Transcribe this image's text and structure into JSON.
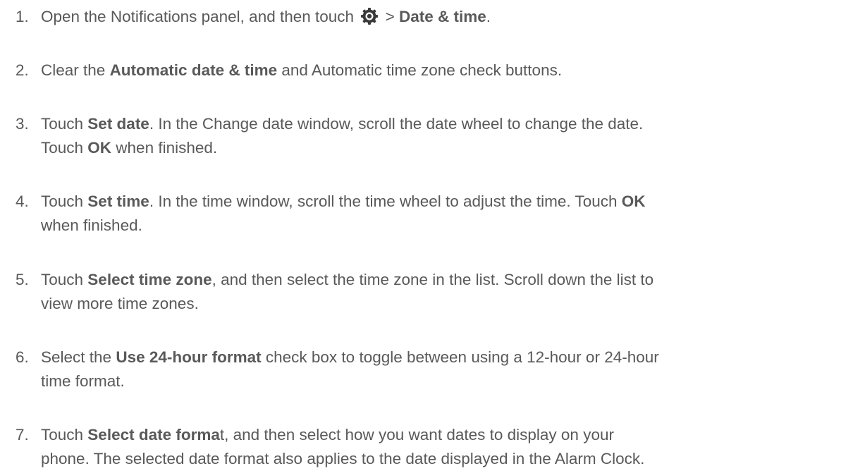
{
  "steps": [
    {
      "num": "1.",
      "line1": {
        "t1": "Open the Notifications panel, and then touch ",
        "sep": " > ",
        "b1": "Date & time",
        "t2": "."
      },
      "icon": "settings-gear-icon"
    },
    {
      "num": "2.",
      "line1": {
        "t1": "Clear the ",
        "b1": "Automatic date & time",
        "t2": " and Automatic time zone check buttons."
      }
    },
    {
      "num": "3.",
      "line1": {
        "t1": "Touch ",
        "b1": "Set date",
        "t2": ". In the Change date window, scroll the date wheel to change the date."
      },
      "line2": {
        "t1": "Touch ",
        "b1": "OK",
        "t2": " when finished."
      }
    },
    {
      "num": "4.",
      "line1": {
        "t1": "Touch ",
        "b1": "Set time",
        "t2": ". In the time window, scroll the time wheel to adjust the time. Touch ",
        "b2": "OK"
      },
      "line2": {
        "t1": "when finished."
      }
    },
    {
      "num": "5.",
      "line1": {
        "t1": "Touch ",
        "b1": "Select time zone",
        "t2": ", and then select the time zone in the list. Scroll down the list to"
      },
      "line2": {
        "t1": "view more time zones."
      }
    },
    {
      "num": "6.",
      "line1": {
        "t1": "Select the ",
        "b1": "Use 24-hour format",
        "t2": " check box to toggle between using a 12-hour or 24-hour"
      },
      "line2": {
        "t1": "time format."
      }
    },
    {
      "num": "7.",
      "line1": {
        "t1": "Touch ",
        "b1": "Select date forma",
        "t2": "t, and then select how you want dates to display on your"
      },
      "line2": {
        "t1": "phone. The selected date format also applies to the date displayed in the Alarm Clock."
      }
    }
  ]
}
